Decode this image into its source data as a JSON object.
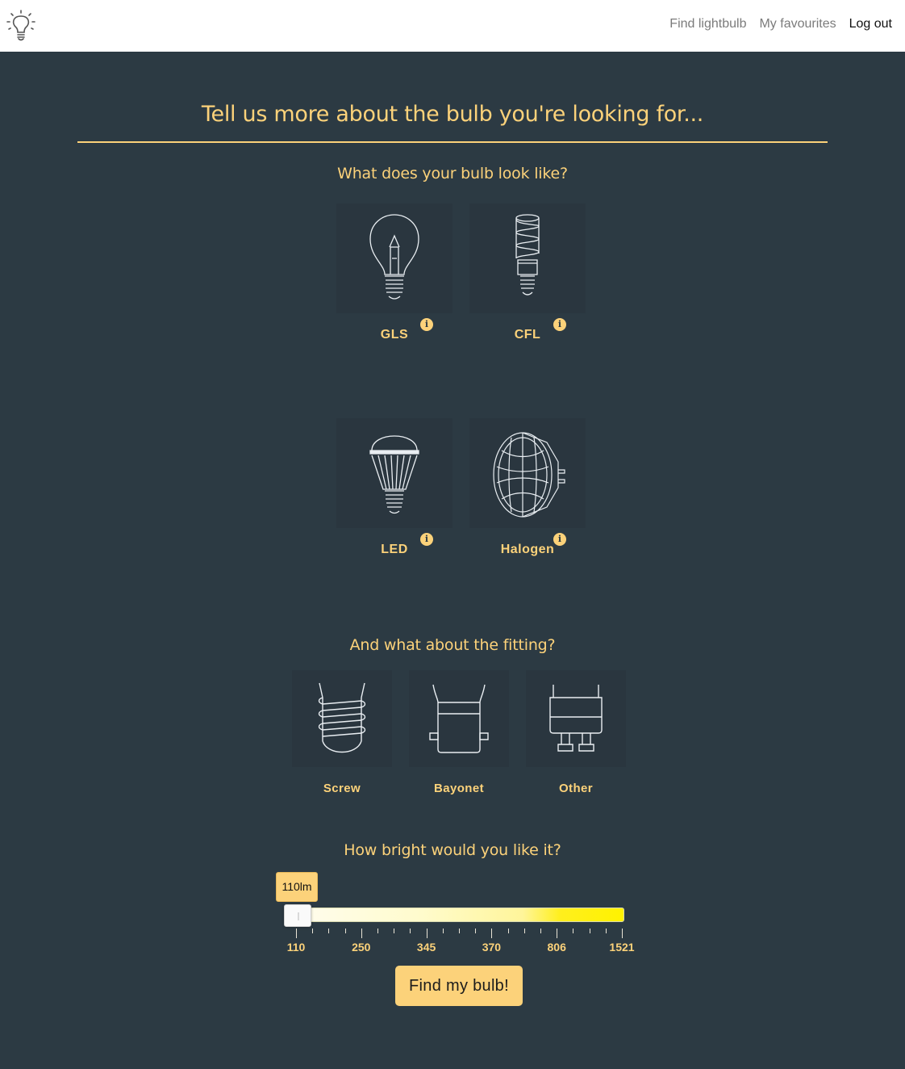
{
  "nav": {
    "logo_icon": "lightbulb-icon",
    "links": [
      "Find lightbulb",
      "My favourites",
      "Log out"
    ]
  },
  "heading": "Tell us more about the bulb you're looking for...",
  "bulb_question": "What does your bulb look like?",
  "bulb_types": [
    {
      "label": "GLS",
      "icon": "gls-bulb-icon"
    },
    {
      "label": "CFL",
      "icon": "cfl-bulb-icon"
    },
    {
      "label": "LED",
      "icon": "led-bulb-icon"
    },
    {
      "label": "Halogen",
      "icon": "halogen-bulb-icon"
    }
  ],
  "info_glyph": "i",
  "fitting_question": "And what about the fitting?",
  "fittings": [
    {
      "label": "Screw",
      "icon": "screw-fitting-icon"
    },
    {
      "label": "Bayonet",
      "icon": "bayonet-fitting-icon"
    },
    {
      "label": "Other",
      "icon": "other-fitting-icon"
    }
  ],
  "brightness_question": "How bright would you like it?",
  "slider": {
    "value_label": "110lm",
    "value": 110,
    "scale_labels": [
      "110",
      "250",
      "345",
      "370",
      "806",
      "1521"
    ]
  },
  "submit_label": "Find my bulb!",
  "colors": {
    "background": "#2c3a43",
    "accent": "#fcd27a",
    "navbar": "#ffffff"
  }
}
